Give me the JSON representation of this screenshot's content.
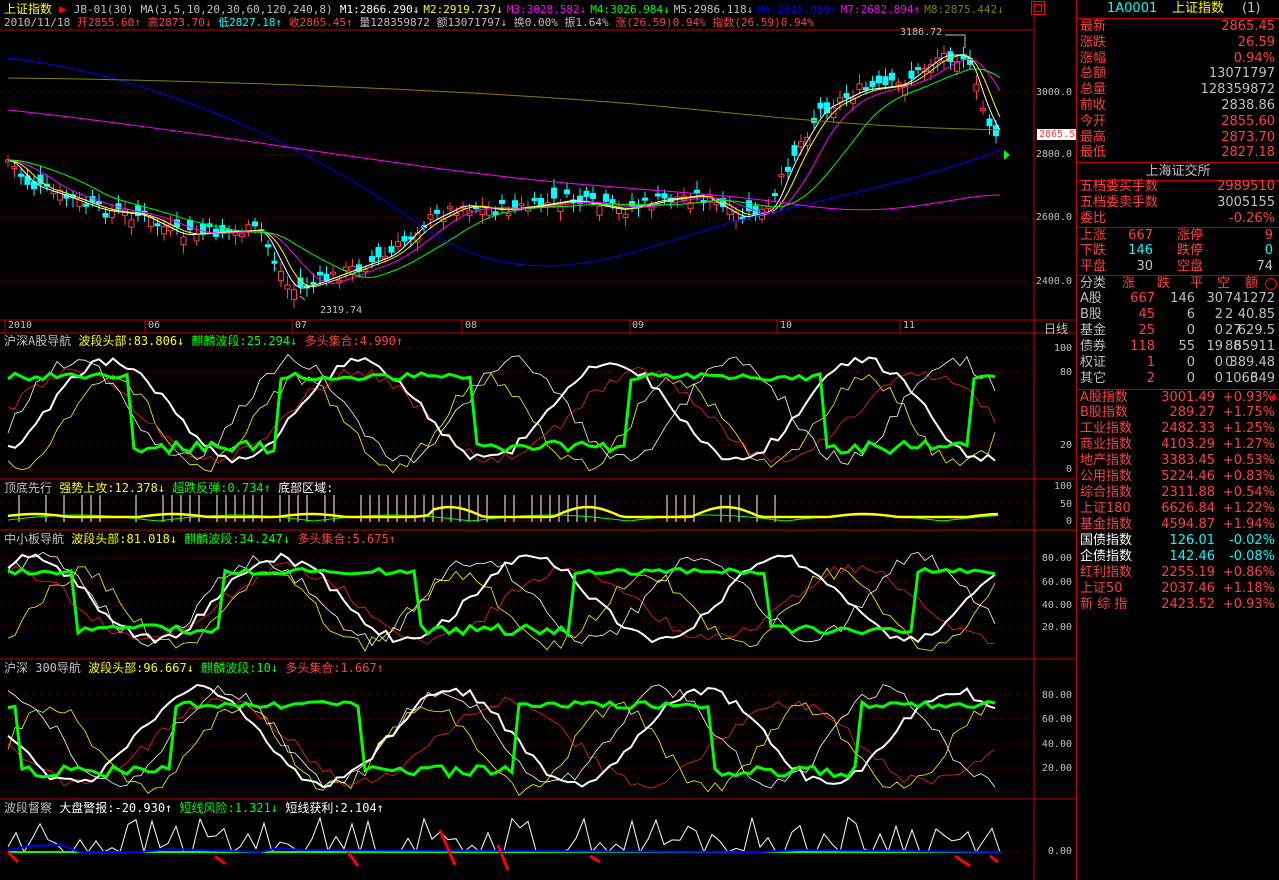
{
  "header": {
    "name": "上证指数",
    "arrow": "▶",
    "formula": "JB-01(30)",
    "ma_params": "MA(3,5,10,20,30,60,120,240,8)",
    "ma": [
      {
        "label": "M1:2866.290↓",
        "color": "#ffffff"
      },
      {
        "label": "M2:2919.737↓",
        "color": "#ffff00"
      },
      {
        "label": "M3:3028.582↓",
        "color": "#ff00ff"
      },
      {
        "label": "M4:3026.984↓",
        "color": "#00ff00"
      },
      {
        "label": "M5:2986.118↓",
        "color": "#c0c0c0"
      },
      {
        "label": "M6:2815.059↑",
        "color": "#0000ff"
      },
      {
        "label": "M7:2682.894↑",
        "color": "#ff00ff"
      },
      {
        "label": "M8:2875.442↓",
        "color": "#808000"
      }
    ],
    "date": "2010/11/18",
    "open": "开2855.60↑",
    "high": "高2873.70↓",
    "low": "低2827.18↑",
    "close": "收2865.45↑",
    "volume": "量128359872",
    "amount": "额13071797↓",
    "turnover": "换0.00%",
    "amplitude": "振1.64%",
    "change": "涨(26.59)0.94%",
    "index_change": "指数(26.59)0.94%"
  },
  "main_axis": [
    "3000.0",
    "2800.0",
    "2600.0",
    "2400.0"
  ],
  "price_tag": "2865.5",
  "annotations": {
    "high": "3186.72",
    "low": "2319.74"
  },
  "months": [
    "2010",
    "06",
    "07",
    "08",
    "09",
    "10",
    "11"
  ],
  "period_label": "日线",
  "panels": {
    "p1": {
      "title": "沪深A股导航",
      "a": "波段头部:83.806↓",
      "b": "麒麟波段:25.294↓",
      "c": "多头集合:4.990↑",
      "axis": [
        "100",
        "80",
        "20",
        "0"
      ]
    },
    "p2": {
      "title": "顶底先行",
      "a": "强势上攻:12.378↓",
      "b": "超跌反弹:0.734↑",
      "c": "底部区域:",
      "axis": [
        "100",
        "50",
        "0"
      ]
    },
    "p3": {
      "title": "中小板导航",
      "a": "波段头部:81.018↓",
      "b": "麒麟波段:34.247↓",
      "c": "多头集合:5.675↑",
      "axis": [
        "80.00",
        "60.00",
        "40.00",
        "20.00"
      ]
    },
    "p4": {
      "title": "沪深 300导航",
      "a": "波段头部:96.667↓",
      "b": "麒麟波段:10↓",
      "c": "多头集合:1.667↑",
      "axis": [
        "80.00",
        "60.00",
        "40.00",
        "20.00"
      ]
    },
    "p5": {
      "title": "波段督察",
      "a": "大盘警报:-20.930↑",
      "b": "短线风险:1.321↓",
      "c": "短线获利:2.104↑",
      "axis": [
        "0.00"
      ]
    }
  },
  "side": {
    "code": "1A0001",
    "name": "上证指数",
    "suffix": "(1)",
    "quote": [
      {
        "l": "最新",
        "v": "2865.45"
      },
      {
        "l": "涨跌",
        "v": "26.59"
      },
      {
        "l": "涨幅",
        "v": "0.94%"
      },
      {
        "l": "总额",
        "v": "13071797"
      },
      {
        "l": "总量",
        "v": "128359872"
      },
      {
        "l": "前收",
        "v": "2838.86"
      },
      {
        "l": "今开",
        "v": "2855.60"
      },
      {
        "l": "最高",
        "v": "2873.70"
      },
      {
        "l": "最低",
        "v": "2827.18"
      }
    ],
    "exchange": "上海证交所",
    "orders": [
      {
        "l": "五档委买手数",
        "v": "2989510"
      },
      {
        "l": "五档委卖手数",
        "v": "3005155"
      },
      {
        "l": "委比",
        "v": "-0.26%"
      }
    ],
    "breadth": [
      {
        "l1": "上涨",
        "v1": "667",
        "l2": "涨停",
        "v2": "9"
      },
      {
        "l1": "下跌",
        "v1": "146",
        "l2": "跌停",
        "v2": "0"
      },
      {
        "l1": "平盘",
        "v1": "30",
        "l2": "空盘",
        "v2": "74"
      }
    ],
    "cat_header": [
      "分类",
      "涨",
      "跌",
      "平",
      "空",
      "额"
    ],
    "categories": [
      {
        "n": "A股",
        "u": "667",
        "d": "146",
        "f": "30",
        "e": "74",
        "a": "1272"
      },
      {
        "n": "B股",
        "u": "45",
        "d": "6",
        "f": "2",
        "e": "2",
        "a": "40.85"
      },
      {
        "n": "基金",
        "u": "25",
        "d": "0",
        "f": "0",
        "e": "27",
        "a": "629.5"
      },
      {
        "n": "债券",
        "u": "118",
        "d": "55",
        "f": "19",
        "e": "88",
        "a": "65911"
      },
      {
        "n": "权证",
        "u": "1",
        "d": "0",
        "f": "0",
        "e": "0",
        "a": "389.48"
      },
      {
        "n": "其它",
        "u": "2",
        "d": "0",
        "f": "0",
        "e": "1066",
        "a": "349"
      }
    ],
    "indices": [
      {
        "n": "A股指数",
        "v": "3001.49",
        "c": "+0.93%",
        "col": "#ff4040"
      },
      {
        "n": "B股指数",
        "v": "289.27",
        "c": "+1.75%",
        "col": "#ff4040"
      },
      {
        "n": "工业指数",
        "v": "2482.33",
        "c": "+1.25%",
        "col": "#ff4040"
      },
      {
        "n": "商业指数",
        "v": "4103.29",
        "c": "+1.27%",
        "col": "#ff4040"
      },
      {
        "n": "地产指数",
        "v": "3383.45",
        "c": "+0.53%",
        "col": "#ff4040"
      },
      {
        "n": "公用指数",
        "v": "5224.46",
        "c": "+0.83%",
        "col": "#ff4040"
      },
      {
        "n": "综合指数",
        "v": "2311.88",
        "c": "+0.54%",
        "col": "#ff4040"
      },
      {
        "n": "上证180",
        "v": "6626.84",
        "c": "+1.22%",
        "col": "#ff4040"
      },
      {
        "n": "基金指数",
        "v": "4594.87",
        "c": "+1.94%",
        "col": "#ff4040"
      },
      {
        "n": "国债指数",
        "v": "126.01",
        "c": "-0.02%",
        "col": "#00ffff"
      },
      {
        "n": "企债指数",
        "v": "142.46",
        "c": "-0.08%",
        "col": "#00ffff"
      },
      {
        "n": "红利指数",
        "v": "2255.19",
        "c": "+0.86%",
        "col": "#ff4040"
      },
      {
        "n": "上证50",
        "v": "2037.46",
        "c": "+1.18%",
        "col": "#ff4040"
      },
      {
        "n": "新 综 指",
        "v": "2423.52",
        "c": "+0.93%",
        "col": "#ff4040"
      }
    ]
  }
}
